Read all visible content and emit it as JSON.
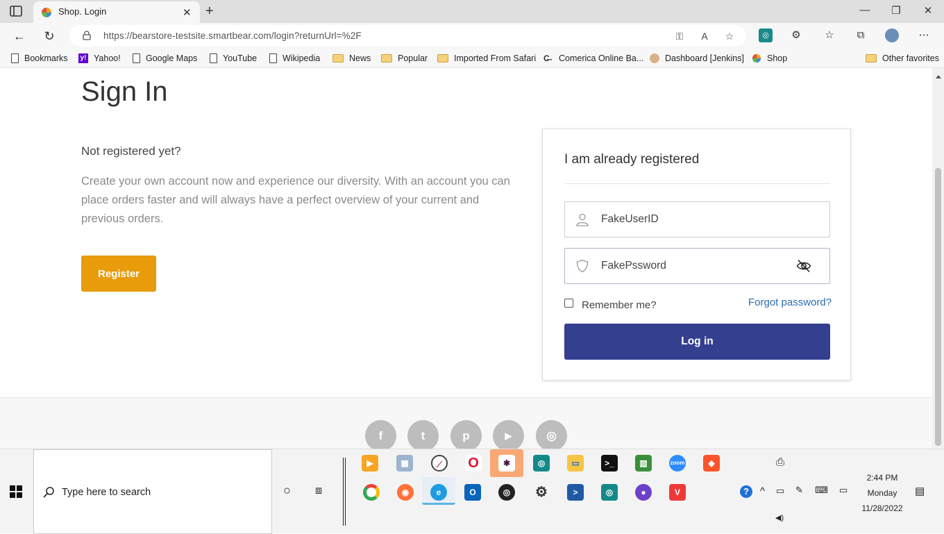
{
  "browser": {
    "tab_title": "Shop. Login",
    "url": "https://bearstore-testsite.smartbear.com/login?returnUrl=%2F",
    "bookmarks": [
      {
        "label": "Bookmarks",
        "icon": "page-icon"
      },
      {
        "label": "Yahoo!",
        "icon": "yahoo-icon"
      },
      {
        "label": "Google Maps",
        "icon": "page-icon"
      },
      {
        "label": "YouTube",
        "icon": "page-icon"
      },
      {
        "label": "Wikipedia",
        "icon": "page-icon"
      },
      {
        "label": "News",
        "icon": "folder-icon"
      },
      {
        "label": "Popular",
        "icon": "folder-icon"
      },
      {
        "label": "Imported From Safari",
        "icon": "folder-icon"
      },
      {
        "label": "Comerica Online Ba...",
        "icon": "comerica-icon"
      },
      {
        "label": "Dashboard [Jenkins]",
        "icon": "jenkins-icon"
      },
      {
        "label": "Shop",
        "icon": "shop-icon"
      },
      {
        "label": "Other favorites",
        "icon": "folder-icon"
      }
    ]
  },
  "page": {
    "heading": "Sign In",
    "not_registered": "Not registered yet?",
    "intro": "Create your own account now and experience our diversity. With an account you can place orders faster and will always have a perfect overview of your current and previous orders.",
    "register_label": "Register",
    "login_card": {
      "title": "I am already registered",
      "username_value": "FakeUserID",
      "password_value": "FakePssword",
      "remember_label": "Remember me?",
      "remember_checked": false,
      "forgot_label": "Forgot password?",
      "login_label": "Log in"
    },
    "social": [
      "f",
      "t",
      "p",
      "▶",
      "◎"
    ]
  },
  "taskbar": {
    "search_placeholder": "Type here to search",
    "time": "2:44 PM",
    "day": "Monday",
    "date": "11/28/2022"
  },
  "colors": {
    "register": "#e89b0b",
    "login": "#353f8f",
    "link": "#2b6cb0"
  }
}
